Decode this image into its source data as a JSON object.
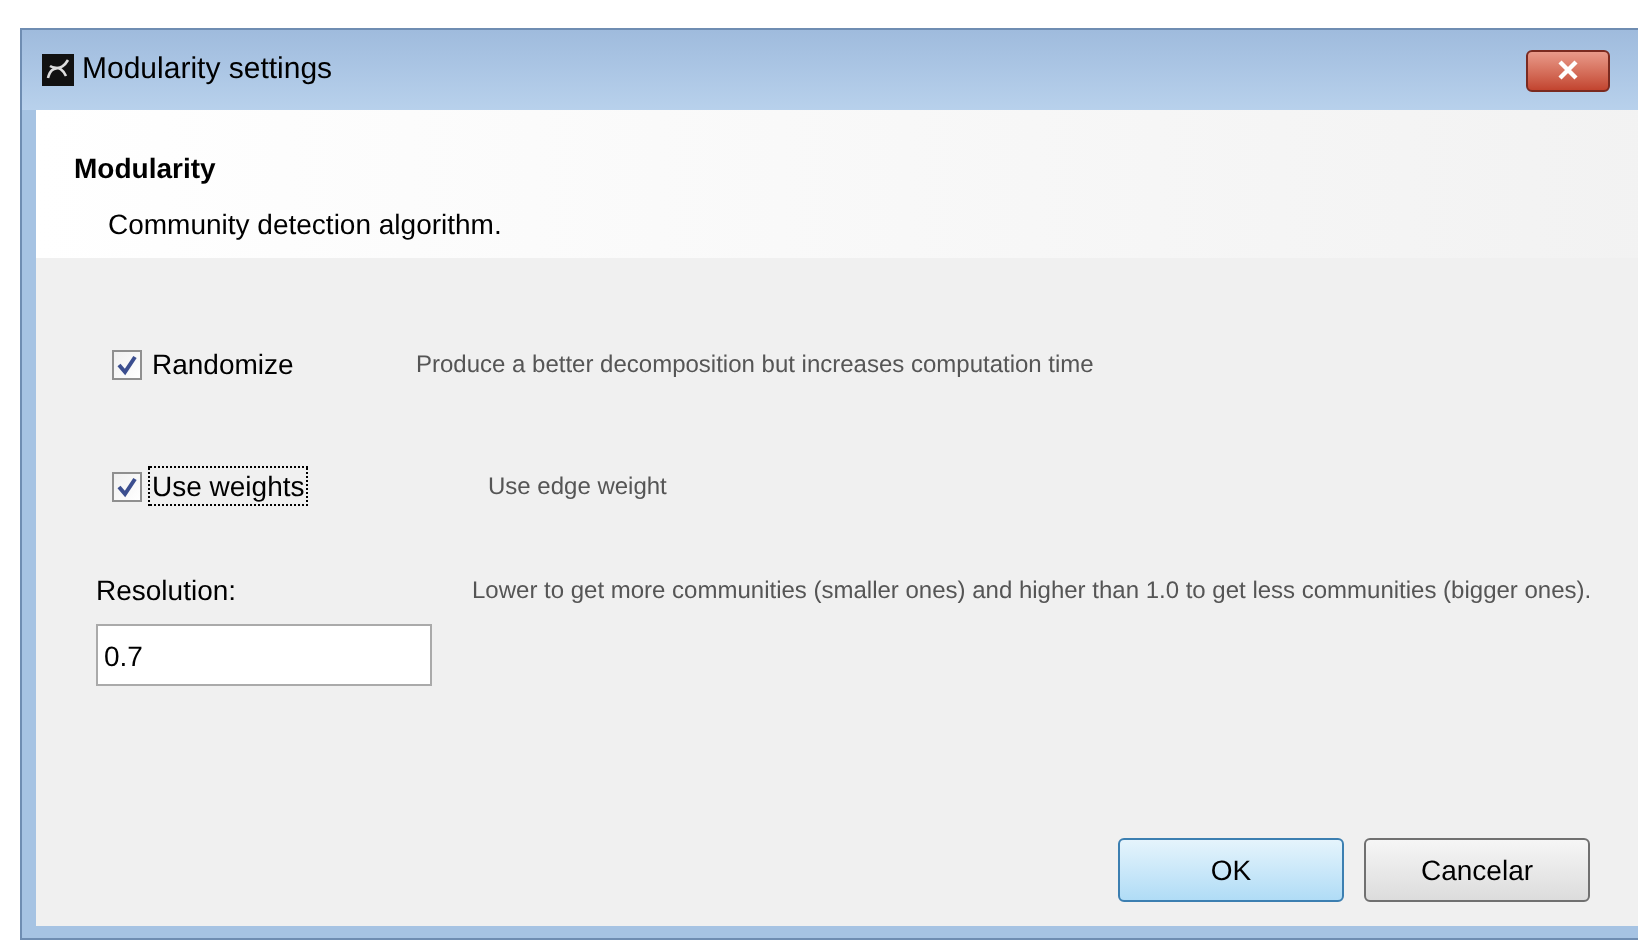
{
  "window": {
    "title": "Modularity settings"
  },
  "header": {
    "title": "Modularity",
    "description": "Community detection algorithm."
  },
  "options": [
    {
      "kind": "checkbox",
      "label": "Randomize",
      "checked": true,
      "focused": false,
      "hint": "Produce a better decomposition but increases computation time"
    },
    {
      "kind": "checkbox",
      "label": "Use weights",
      "checked": true,
      "focused": true,
      "hint": "Use edge weight"
    }
  ],
  "resolution": {
    "label": "Resolution:",
    "value": "0.7",
    "hint": "Lower to get more communities (smaller ones) and higher than 1.0 to get less communities (bigger ones)."
  },
  "buttons": [
    {
      "label": "OK",
      "default": true
    },
    {
      "label": "Cancelar",
      "default": false
    }
  ]
}
